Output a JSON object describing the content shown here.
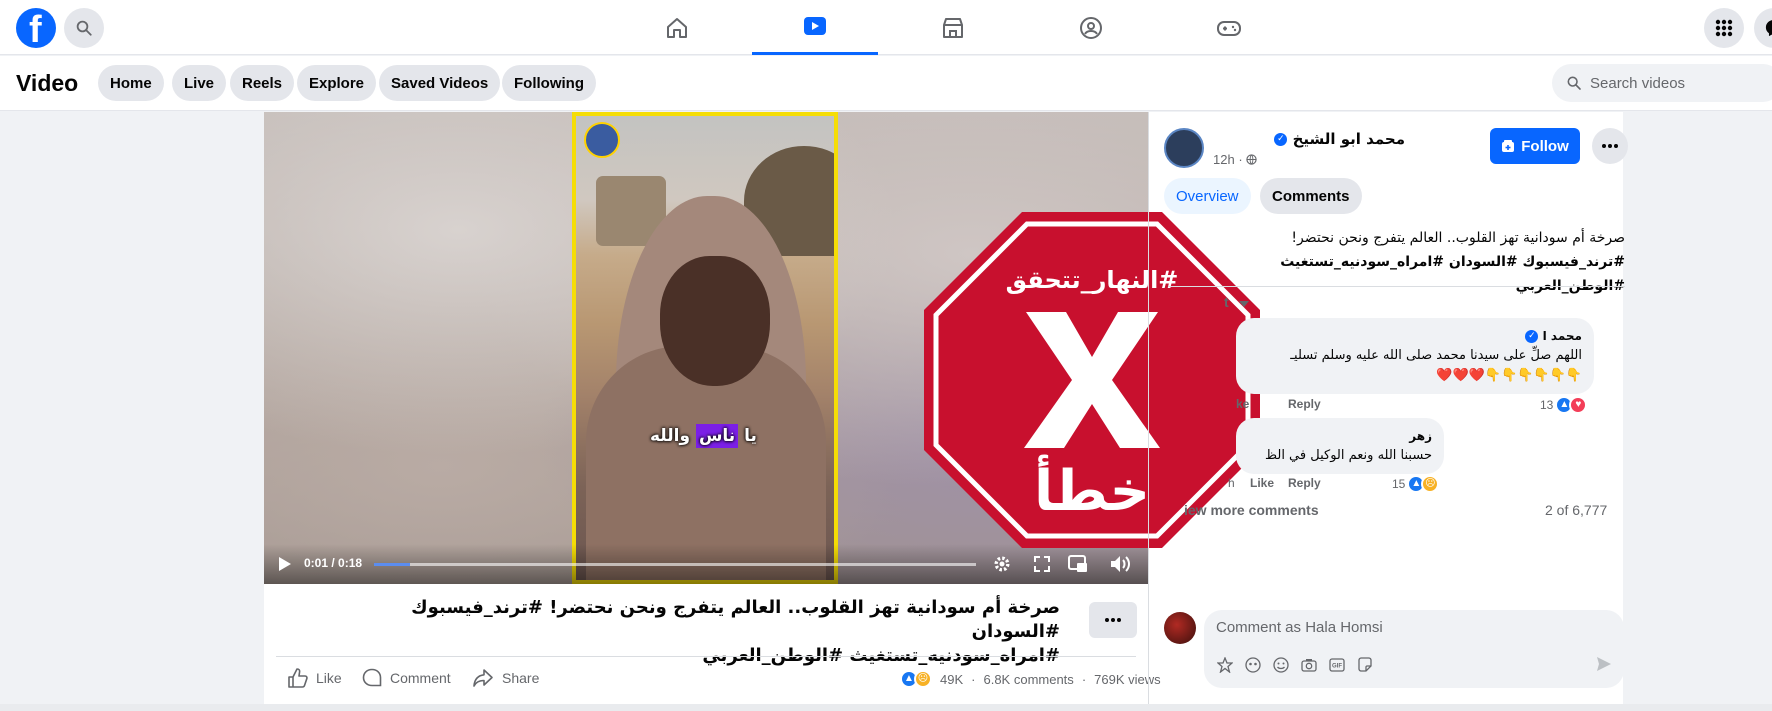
{
  "topbar": {
    "logo_letter": "f",
    "nav_icons": [
      "home-icon",
      "video-icon",
      "marketplace-icon",
      "groups-icon",
      "gaming-icon"
    ],
    "active_tab": "video-icon"
  },
  "subheader": {
    "title": "Video",
    "pills": [
      "Home",
      "Live",
      "Reels",
      "Explore",
      "Saved Videos",
      "Following"
    ],
    "search_placeholder": "Search videos"
  },
  "video": {
    "caption_word1": "يا",
    "caption_highlight": "ناس",
    "caption_word2": "والله",
    "current_time": "0:01",
    "duration": "0:18",
    "time_display": "0:01 / 0:18",
    "progress_fraction": 0.06
  },
  "stamp": {
    "hashtag": "#النهار_تتحقق",
    "verdict": "خطأ",
    "color": "#c8102e"
  },
  "post": {
    "title_line1": "صرخة أم سودانية تهز القلوب.. العالم يتفرج ونحن نحتضر! #ترند_فيسبوك #السودان",
    "title_line2": "#امراه_سودنيه_تستغيث #الوطن_العربي",
    "actions": {
      "like": "Like",
      "comment": "Comment",
      "share": "Share"
    },
    "reactions_count": "49K",
    "comments_count": "6.8K comments",
    "views_count": "769K views"
  },
  "sidebar": {
    "author": "محمد ابو الشيخ",
    "time": "12h",
    "follow_label": "Follow",
    "tabs": [
      "Overview",
      "Comments"
    ],
    "desc_line1": "صرخة أم سودانية تهز القلوب.. العالم يتفرج ونحن نحتضر!",
    "desc_line2": "#ترند_فيسبوك #السودان #امراه_سودنيه_تستغيث #الوطن_العربي",
    "sort_label_partial": "t",
    "comments": [
      {
        "name_partial": "محمد ا",
        "text_line1": "اللهم صلِّ على سيدنا محمد صلى الله عليه وسلم تسليـ",
        "text_line2": "👇👇👇👇👇👇❤️❤️❤️",
        "like_label": "Like",
        "meta_partial": "ke",
        "reply_label": "Reply",
        "reactions": "13"
      },
      {
        "name_partial": "زهر",
        "text_line1": "حسبنا الله ونعم الوكيل في الظ",
        "time_partial": "h",
        "like_label": "Like",
        "reply_label": "Reply",
        "reactions": "15"
      }
    ],
    "view_more": "iew more comments",
    "comment_count": "2 of 6,777",
    "composer_placeholder": "Comment as Hala Homsi"
  },
  "colors": {
    "brand": "#0866ff",
    "stamp_red": "#c8102e",
    "frame_yellow": "#f5dd06"
  }
}
